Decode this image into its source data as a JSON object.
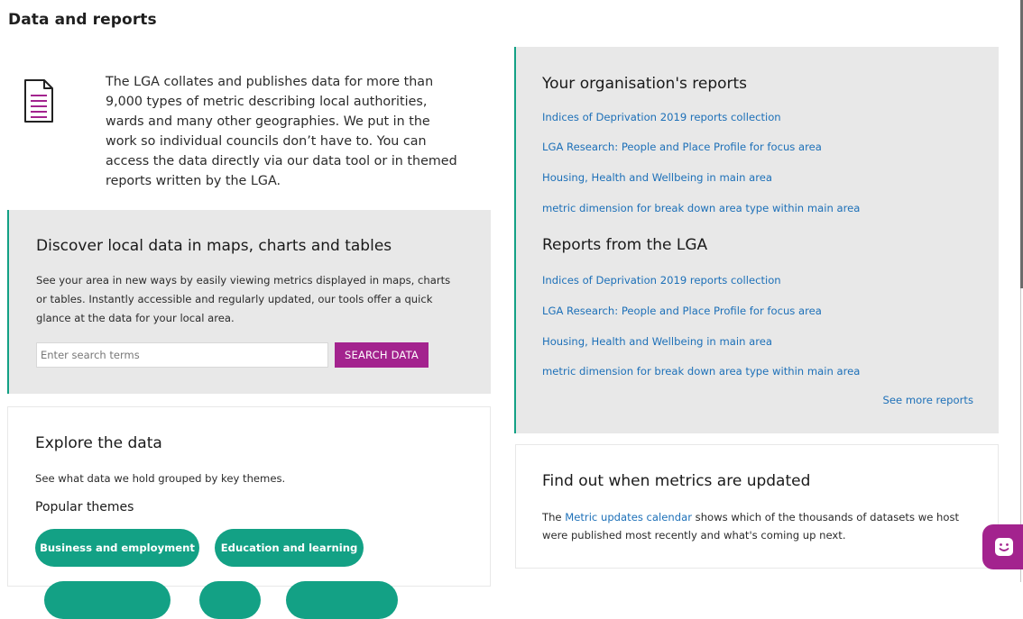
{
  "page": {
    "title": "Data and reports"
  },
  "intro": {
    "icon": "document-icon",
    "text": "The LGA collates and publishes data for more than 9,000 types of metric describing local authorities, wards and many other geographies. We put in the work so individual councils don’t have to. You can access the data directly via our data tool or in themed reports written by the LGA."
  },
  "discover": {
    "heading": "Discover local data in maps, charts and tables",
    "description": "See your area in new ways by easily viewing metrics displayed in maps, charts or tables. Instantly accessible and regularly updated, our tools offer a quick glance at the data for your local area.",
    "search_placeholder": "Enter search terms",
    "search_button": "SEARCH DATA"
  },
  "explore": {
    "heading": "Explore the data",
    "description": "See what data we hold grouped by key themes.",
    "popular_heading": "Popular themes",
    "themes": [
      "Business and employment",
      "Education and learning"
    ]
  },
  "reports": {
    "org_heading": "Your organisation's reports",
    "org_links": [
      "Indices of Deprivation 2019 reports collection",
      "LGA Research: People and Place Profile for focus area",
      "Housing, Health and Wellbeing in main area",
      "metric dimension for break down area type within main area"
    ],
    "lga_heading": "Reports from the LGA",
    "lga_links": [
      "Indices of Deprivation 2019 reports collection",
      "LGA Research: People and Place Profile for focus area",
      "Housing, Health and Wellbeing in main area",
      "metric dimension for break down area type within main area"
    ],
    "see_more": "See more reports"
  },
  "metrics": {
    "heading": "Find out when metrics are updated",
    "text_prefix": "The ",
    "link": "Metric updates calendar",
    "text_suffix": " shows which of the thousands of datasets we host were published most recently and what's coming up next."
  },
  "chat": {
    "icon": "chat-smile-icon"
  },
  "colors": {
    "accent_green": "#13a185",
    "accent_purple": "#a3238e",
    "link_blue": "#1d70b8",
    "panel_grey": "#e8e8e8"
  }
}
